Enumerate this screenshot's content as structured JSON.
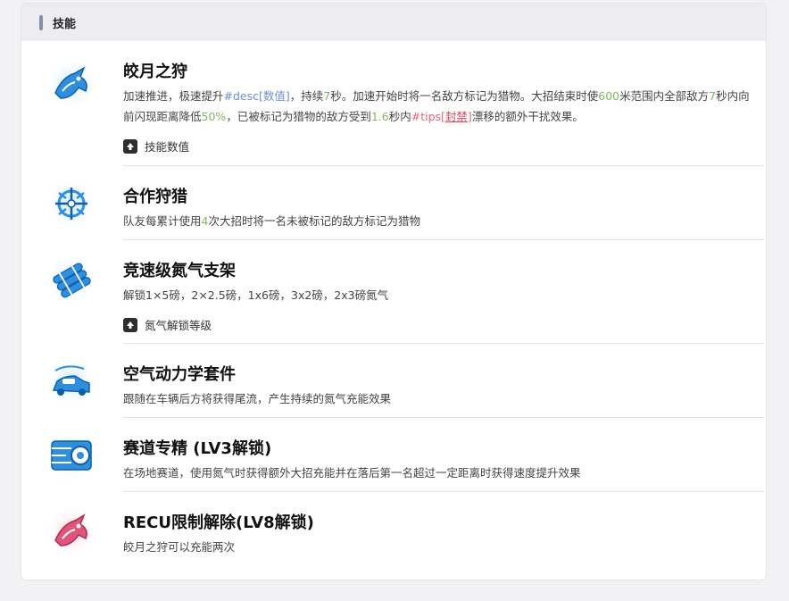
{
  "header": {
    "title": "技能"
  },
  "skills": [
    {
      "name": "皎月之狩",
      "desc": {
        "p1": "加速推进，极速提升",
        "v1": "#desc[数值]",
        "p2": "，持续",
        "v2": "7",
        "p3": "秒。加速开始时将一名敌方标记为猎物。大招结束时使",
        "v3": "600",
        "p4": "米范围内全部敌方",
        "v4": "7",
        "p5": "秒内向前闪现距离降低",
        "v5": "50%",
        "p6": "，已被标记为猎物的敌方受到",
        "v6": "1.6",
        "p7": "秒内",
        "v7a": "#tips[",
        "v7b": "封禁",
        "v7c": "]",
        "p8": "漂移的额外干扰效果。"
      },
      "upgrade": "技能数值",
      "icon": "hunter-moon-icon"
    },
    {
      "name": "合作狩猎",
      "desc": {
        "p1": "队友每累计使用",
        "v1": "4",
        "p2": "次大招时将一名未被标记的敌方标记为猎物"
      },
      "icon": "coop-hunt-icon"
    },
    {
      "name": "竞速级氮气支架",
      "desc": {
        "text": "解锁1×5磅，2×2.5磅，1x6磅，3x2磅，2x3磅氮气"
      },
      "upgrade": "氮气解锁等级",
      "icon": "nitro-rack-icon"
    },
    {
      "name": "空气动力学套件",
      "desc": {
        "text": "跟随在车辆后方将获得尾流，产生持续的氮气充能效果"
      },
      "icon": "aero-kit-icon"
    },
    {
      "name": "赛道专精 (LV3解锁)",
      "desc": {
        "text": "在场地赛道，使用氮气时获得额外大招充能并在落后第一名超过一定距离时获得速度提升效果"
      },
      "icon": "track-master-icon"
    },
    {
      "name": "RECU限制解除(LV8解锁)",
      "desc": {
        "text": "皎月之狩可以充能两次"
      },
      "icon": "recu-unlock-icon"
    }
  ],
  "colors": {
    "highlight_green": "#7dbb5e",
    "highlight_blue": "#6b8fd0",
    "highlight_red": "#e0687a",
    "icon_blue": "#3aa0e8",
    "icon_pink": "#e0557a"
  }
}
